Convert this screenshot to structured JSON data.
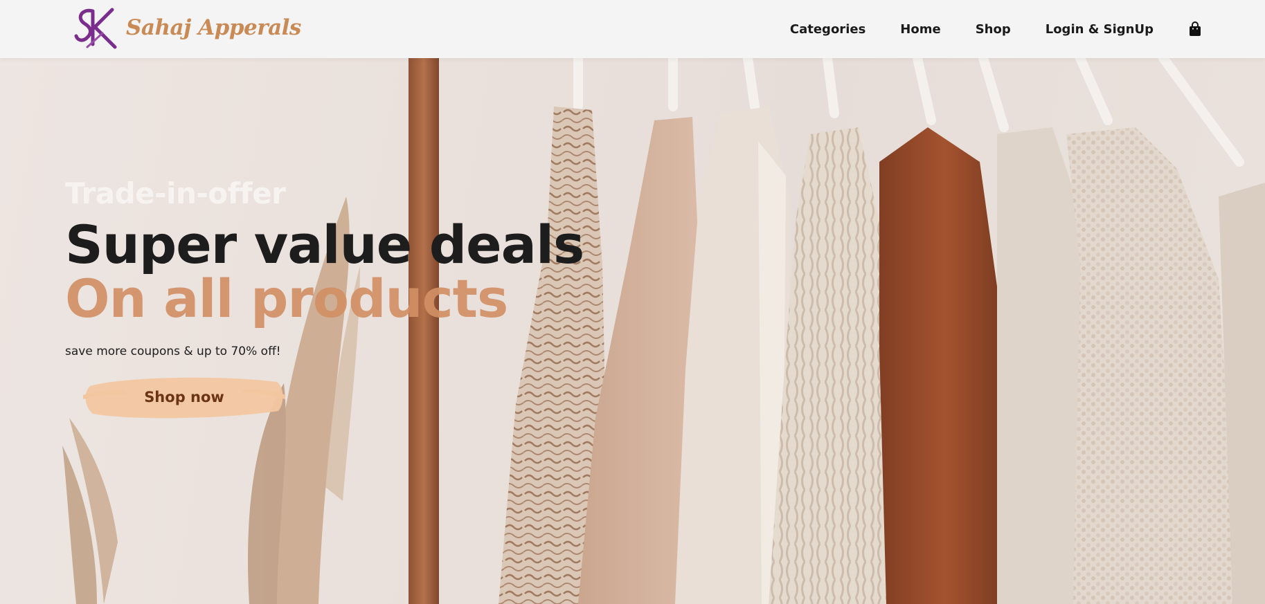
{
  "header": {
    "brand_name": "Sahaj Apperals",
    "nav": {
      "categories": "Categories",
      "home": "Home",
      "shop": "Shop",
      "login": "Login & SignUp"
    },
    "cart_icon": "shopping-bag-icon",
    "logo_icon": "sk-monogram-logo"
  },
  "hero": {
    "kicker": "Trade-in-offer",
    "headline_line1": "Super value deals",
    "headline_line2": "On all products",
    "subtext": "save more coupons & up to 70% off!",
    "cta_label": "Shop now",
    "colors": {
      "accent": "#d39065",
      "cta_bg": "#f2c7a0",
      "cta_text": "#6b3412",
      "brand": "#c98a55",
      "logo": "#7a2d8c"
    }
  }
}
